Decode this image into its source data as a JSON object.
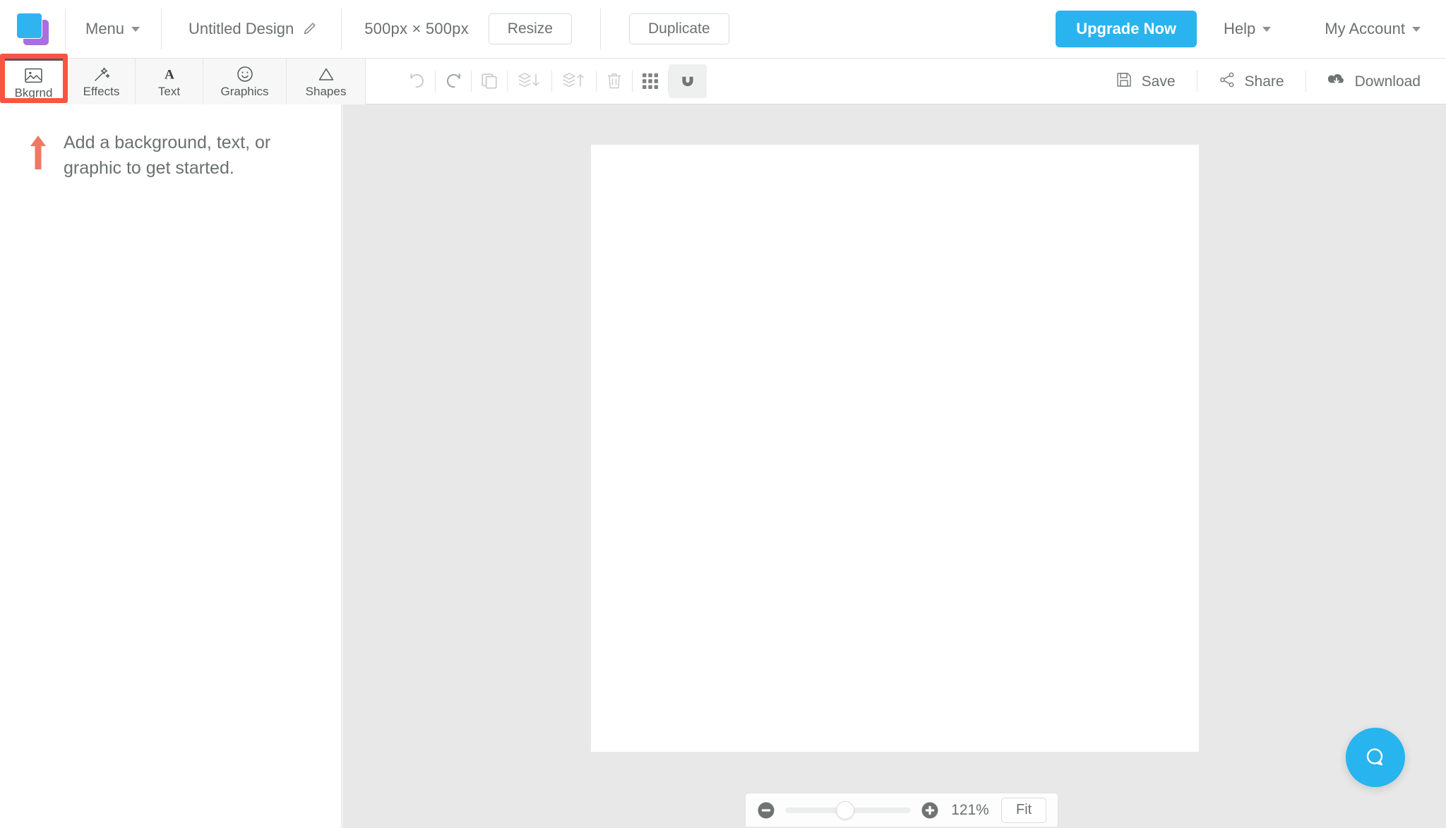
{
  "app": {
    "name": "design-editor",
    "accent_color": "#29b4ef",
    "annotation_color": "#fb5442",
    "canvas_bg": "#ffffff",
    "workspace_bg": "#e8e8e8"
  },
  "header": {
    "logo": "stacked-squares-logo",
    "menu_label": "Menu",
    "doc_title": "Untitled Design",
    "doc_title_edit_icon": "pencil-icon",
    "dimensions": "500px × 500px",
    "resize_label": "Resize",
    "duplicate_label": "Duplicate",
    "upgrade_label": "Upgrade Now",
    "help_label": "Help",
    "account_label": "My Account"
  },
  "toolbar": {
    "tabs": [
      {
        "label": "Bkgrnd",
        "icon": "image-icon",
        "active": true
      },
      {
        "label": "Effects",
        "icon": "magic-wand-icon",
        "active": false
      },
      {
        "label": "Text",
        "icon": "letter-a-icon",
        "active": false
      },
      {
        "label": "Graphics",
        "icon": "smiley-icon",
        "active": false
      },
      {
        "label": "Shapes",
        "icon": "triangle-icon",
        "active": false
      }
    ],
    "actions": [
      {
        "name": "undo",
        "icon": "undo-arrow-icon"
      },
      {
        "name": "redo",
        "icon": "redo-arrow-icon"
      },
      {
        "name": "duplicate-layer",
        "icon": "copy-icon"
      },
      {
        "name": "send-backward",
        "icon": "layers-down-icon"
      },
      {
        "name": "bring-forward",
        "icon": "layers-up-icon"
      },
      {
        "name": "delete",
        "icon": "trash-icon"
      },
      {
        "name": "grid",
        "icon": "grid-dots-icon"
      },
      {
        "name": "snap",
        "icon": "magnet-icon",
        "active": true
      }
    ],
    "save_label": "Save",
    "share_label": "Share",
    "download_label": "Download"
  },
  "sidebar": {
    "hint_icon": "up-arrow-icon",
    "hint_text": "Add a background, text, or graphic to get started."
  },
  "zoombar": {
    "zoom_out_icon": "minus-circle-icon",
    "zoom_in_icon": "plus-circle-icon",
    "zoom_value": "121%",
    "fit_label": "Fit",
    "slider_position_percent": 48
  },
  "help_widget": {
    "icon": "chat-bubble-icon"
  }
}
